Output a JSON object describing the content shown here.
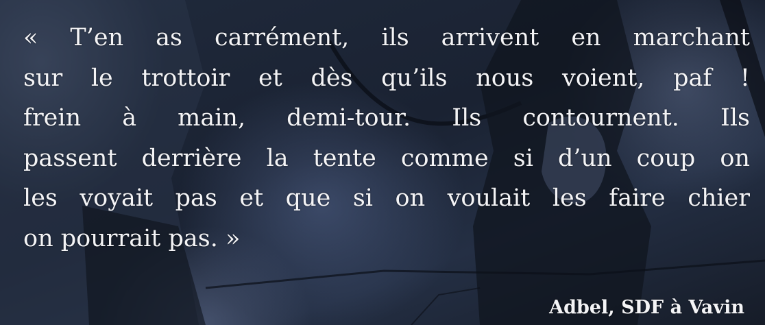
{
  "quote": {
    "lines": [
      "« T’en as carrément, ils arrivent en marchant",
      "sur le trottoir et dès qu’ils nous voient, paf !",
      "frein à main, demi-tour. Ils contournent. Ils",
      "passent derrière la tente comme si d’un coup on",
      "les voyait pas et que si on voulait les faire chier",
      "on pourrait pas. »"
    ]
  },
  "attribution": "Adbel, SDF à Vavin",
  "colors": {
    "text": "#f4f4f6",
    "background": "#1a2232"
  }
}
